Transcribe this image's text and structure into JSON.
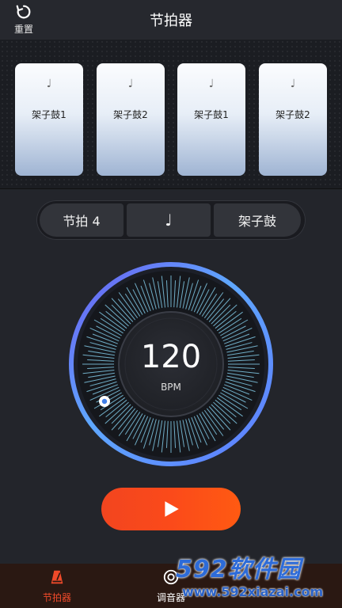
{
  "header": {
    "title": "节拍器",
    "reset_label": "重置"
  },
  "beats": [
    {
      "note": "♩",
      "name": "架子鼓1"
    },
    {
      "note": "♩",
      "name": "架子鼓2"
    },
    {
      "note": "♩",
      "name": "架子鼓1"
    },
    {
      "note": "♩",
      "name": "架子鼓2"
    }
  ],
  "controls": {
    "time_signature": "节拍 4",
    "note_value": "♩",
    "sound": "架子鼓"
  },
  "tempo": {
    "value": "120",
    "unit": "BPM"
  },
  "tabs": [
    {
      "label": "节拍器",
      "active": true,
      "color": "#f04a2a"
    },
    {
      "label": "调音器",
      "active": false,
      "color": "#ffffff"
    }
  ],
  "watermark": {
    "brand": "592软件园",
    "url": "www.592xiazai.com"
  },
  "colors": {
    "accent": "#fb4a1a",
    "dial_ring": "#5aa3ff",
    "dial_ticks": "#8fe0ff"
  }
}
